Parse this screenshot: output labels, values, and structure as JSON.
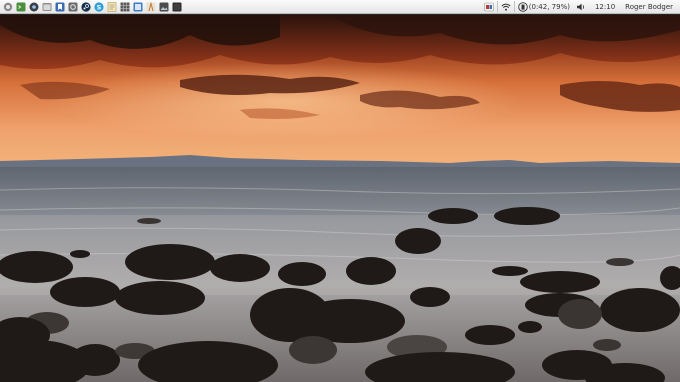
{
  "panel": {
    "launchers": [
      {
        "name": "app-menu-icon",
        "color": "#7a7a7a"
      },
      {
        "name": "terminal-icon",
        "color": "#4a8f3c"
      },
      {
        "name": "chromium-icon",
        "color": "#3a3f47"
      },
      {
        "name": "file-manager-icon",
        "color": "#8e8e8e"
      },
      {
        "name": "bookmark-icon",
        "color": "#3b6ab1"
      },
      {
        "name": "settings-icon",
        "color": "#6b6b6b"
      },
      {
        "name": "steam-icon",
        "color": "#16304a"
      },
      {
        "name": "skype-icon",
        "color": "#2d9fd9"
      },
      {
        "name": "text-editor-icon",
        "color": "#d7b76a"
      },
      {
        "name": "spreadsheet-icon",
        "color": "#5a5a5a"
      },
      {
        "name": "document-icon",
        "color": "#3f7bc4"
      },
      {
        "name": "presentation-icon",
        "color": "#c07a2f"
      },
      {
        "name": "image-viewer-icon",
        "color": "#4c4c4c"
      },
      {
        "name": "monitor-icon",
        "color": "#2d2d2d"
      }
    ],
    "tray": {
      "battery_text": "(0:42, 79%)",
      "battery_percent": 79,
      "clock": "12:10",
      "user": "Roger Bodger"
    }
  },
  "wallpaper": {
    "description_colors": {
      "sky_top": "#3a1a12",
      "sky_mid": "#c85a2a",
      "horizon": "#f2b27a",
      "sea": "#8b8e95",
      "rocks": "#1f1a18"
    }
  }
}
